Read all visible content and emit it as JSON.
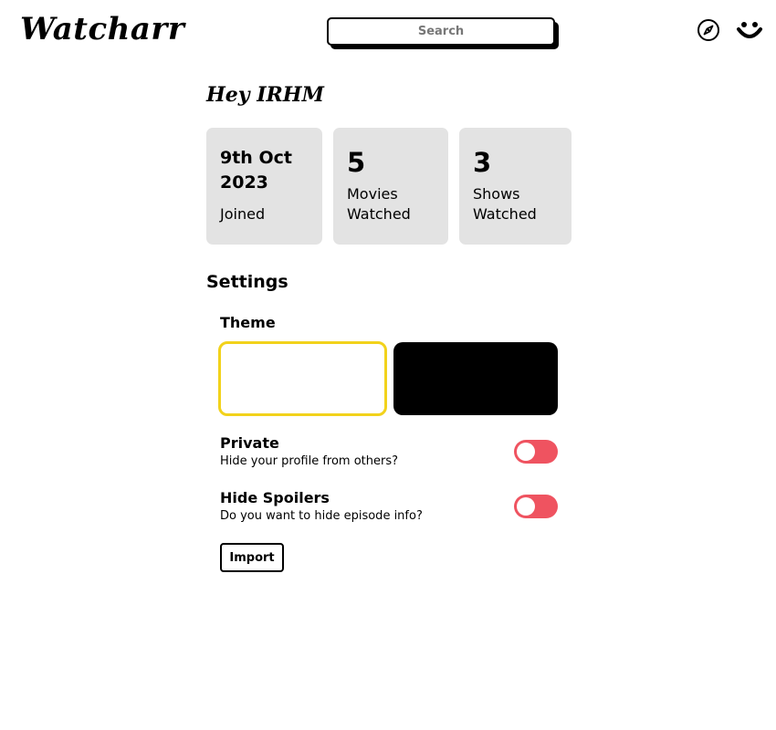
{
  "header": {
    "logo": "Watcharr",
    "search": {
      "placeholder": "Search",
      "value": ""
    },
    "icons": [
      "compass-icon",
      "smiley-icon"
    ]
  },
  "profile": {
    "greeting": "Hey IRHM",
    "stats": {
      "joined": {
        "value": "9th Oct 2023",
        "label": "Joined"
      },
      "movies": {
        "value": "5",
        "label": "Movies Watched"
      },
      "shows": {
        "value": "3",
        "label": "Shows Watched"
      }
    }
  },
  "settings": {
    "title": "Settings",
    "theme": {
      "label": "Theme",
      "selected": "light",
      "accent": "#f2d21b"
    },
    "private": {
      "name": "Private",
      "description": "Hide your profile from others?",
      "enabled": false
    },
    "hide_spoilers": {
      "name": "Hide Spoilers",
      "description": "Do you want to hide episode info?",
      "enabled": false
    },
    "toggle_color": "#ef5360",
    "import_label": "Import"
  }
}
